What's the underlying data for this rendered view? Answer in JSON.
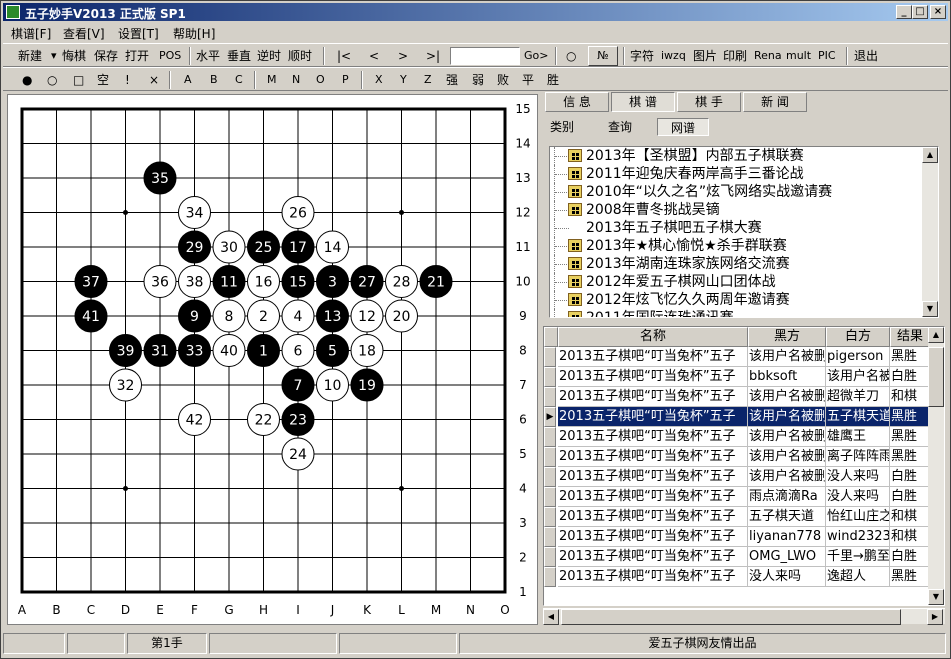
{
  "window": {
    "title": "五子妙手V2013 正式版 SP1",
    "controls": [
      "_",
      "□",
      "×"
    ]
  },
  "menu": [
    "棋谱[F]",
    "查看[V]",
    "设置[T]",
    "帮助[H]"
  ],
  "toolbar1": {
    "file": [
      "新建",
      "悔棋",
      "保存",
      "打开",
      "POS"
    ],
    "view": [
      "水平",
      "垂直",
      "逆时",
      "顺时"
    ],
    "nav": [
      "|<",
      "<",
      ">",
      ">|"
    ],
    "move_input": "",
    "go": "Go>",
    "extra": [
      "○",
      "№"
    ],
    "tools": [
      "字符",
      "iwzq",
      "图片",
      "印刷",
      "Rena",
      "mult",
      "PIC"
    ],
    "exit": "退出"
  },
  "toolbar2": {
    "marks": [
      "●",
      "○",
      "□",
      "空",
      "!",
      "×"
    ],
    "letters": [
      "A",
      "B",
      "C",
      "M",
      "N",
      "O",
      "P",
      "X",
      "Y",
      "Z",
      "强",
      "弱",
      "败",
      "平",
      "胜"
    ]
  },
  "board": {
    "cols": [
      "A",
      "B",
      "C",
      "D",
      "E",
      "F",
      "G",
      "H",
      "I",
      "J",
      "K",
      "L",
      "M",
      "N",
      "O"
    ],
    "rows": [
      "15",
      "14",
      "13",
      "12",
      "11",
      "10",
      "9",
      "8",
      "7",
      "6",
      "5",
      "4",
      "3",
      "2",
      "1"
    ],
    "stars": [
      [
        3,
        3
      ],
      [
        11,
        3
      ],
      [
        7,
        7
      ],
      [
        3,
        11
      ],
      [
        11,
        11
      ]
    ],
    "stones": [
      {
        "n": "1",
        "c": "b",
        "col": "H",
        "row": "8"
      },
      {
        "n": "2",
        "c": "w",
        "col": "H",
        "row": "9"
      },
      {
        "n": "3",
        "c": "b",
        "col": "J",
        "row": "10"
      },
      {
        "n": "4",
        "c": "w",
        "col": "I",
        "row": "9"
      },
      {
        "n": "5",
        "c": "b",
        "col": "J",
        "row": "8"
      },
      {
        "n": "6",
        "c": "w",
        "col": "I",
        "row": "8"
      },
      {
        "n": "7",
        "c": "b",
        "col": "I",
        "row": "7"
      },
      {
        "n": "8",
        "c": "w",
        "col": "G",
        "row": "9"
      },
      {
        "n": "9",
        "c": "b",
        "col": "F",
        "row": "9"
      },
      {
        "n": "10",
        "c": "w",
        "col": "J",
        "row": "7"
      },
      {
        "n": "11",
        "c": "b",
        "col": "G",
        "row": "10"
      },
      {
        "n": "12",
        "c": "w",
        "col": "K",
        "row": "9"
      },
      {
        "n": "13",
        "c": "b",
        "col": "J",
        "row": "9"
      },
      {
        "n": "14",
        "c": "w",
        "col": "J",
        "row": "11"
      },
      {
        "n": "15",
        "c": "b",
        "col": "I",
        "row": "10"
      },
      {
        "n": "16",
        "c": "w",
        "col": "H",
        "row": "10"
      },
      {
        "n": "17",
        "c": "b",
        "col": "I",
        "row": "11"
      },
      {
        "n": "18",
        "c": "w",
        "col": "K",
        "row": "8"
      },
      {
        "n": "19",
        "c": "b",
        "col": "K",
        "row": "7"
      },
      {
        "n": "20",
        "c": "w",
        "col": "L",
        "row": "9"
      },
      {
        "n": "21",
        "c": "b",
        "col": "M",
        "row": "10"
      },
      {
        "n": "22",
        "c": "w",
        "col": "H",
        "row": "6"
      },
      {
        "n": "23",
        "c": "b",
        "col": "I",
        "row": "6"
      },
      {
        "n": "24",
        "c": "w",
        "col": "I",
        "row": "5"
      },
      {
        "n": "25",
        "c": "b",
        "col": "H",
        "row": "11"
      },
      {
        "n": "26",
        "c": "w",
        "col": "I",
        "row": "12"
      },
      {
        "n": "27",
        "c": "b",
        "col": "K",
        "row": "10"
      },
      {
        "n": "28",
        "c": "w",
        "col": "L",
        "row": "10"
      },
      {
        "n": "29",
        "c": "b",
        "col": "F",
        "row": "11"
      },
      {
        "n": "30",
        "c": "w",
        "col": "G",
        "row": "11"
      },
      {
        "n": "31",
        "c": "b",
        "col": "E",
        "row": "8"
      },
      {
        "n": "32",
        "c": "w",
        "col": "D",
        "row": "7"
      },
      {
        "n": "33",
        "c": "b",
        "col": "F",
        "row": "8"
      },
      {
        "n": "34",
        "c": "w",
        "col": "F",
        "row": "12"
      },
      {
        "n": "35",
        "c": "b",
        "col": "E",
        "row": "13"
      },
      {
        "n": "36",
        "c": "w",
        "col": "E",
        "row": "10"
      },
      {
        "n": "37",
        "c": "b",
        "col": "C",
        "row": "10"
      },
      {
        "n": "38",
        "c": "w",
        "col": "F",
        "row": "10"
      },
      {
        "n": "39",
        "c": "b",
        "col": "D",
        "row": "8"
      },
      {
        "n": "40",
        "c": "w",
        "col": "G",
        "row": "8"
      },
      {
        "n": "41",
        "c": "b",
        "col": "C",
        "row": "9"
      },
      {
        "n": "42",
        "c": "w",
        "col": "F",
        "row": "6"
      }
    ]
  },
  "tabs": [
    "信 息",
    "棋 谱",
    "棋 手",
    "新 闻"
  ],
  "subtabs": [
    "类别",
    "查询",
    "网谱"
  ],
  "tree": [
    "2013年【圣棋盟】内部五子棋联赛",
    "2011年迎兔庆春两岸高手三番论战",
    "2010年“以久之名”炫飞网络实战邀请赛",
    "2008年曹冬挑战吴镝",
    "2013年五子棋吧五子棋大赛",
    "2013年★棋心愉悦★杀手群联赛",
    "2013年湖南连珠家族网络交流赛",
    "2012年爱五子棋网山口团体战",
    "2012年炫飞忆久久两周年邀请赛",
    "2011年国际连珠通讯赛"
  ],
  "grid": {
    "headers": [
      "名称",
      "黑方",
      "白方",
      "结果"
    ],
    "rows": [
      [
        "2013五子棋吧“叮当兔杯”五子",
        "该用户名被删",
        "pigerson",
        "黑胜"
      ],
      [
        "2013五子棋吧“叮当兔杯”五子",
        "bbksoft",
        "该用户名被删",
        "白胜"
      ],
      [
        "2013五子棋吧“叮当兔杯”五子",
        "该用户名被删",
        "超微羊刀",
        "和棋"
      ],
      [
        "2013五子棋吧“叮当兔杯”五子",
        "该用户名被删",
        "五子棋天道",
        "黑胜"
      ],
      [
        "2013五子棋吧“叮当兔杯”五子",
        "该用户名被删",
        "雄鹰王",
        "黑胜"
      ],
      [
        "2013五子棋吧“叮当兔杯”五子",
        "该用户名被删",
        "离子阵阵雨",
        "黑胜"
      ],
      [
        "2013五子棋吧“叮当兔杯”五子",
        "该用户名被删",
        "没人来吗",
        "白胜"
      ],
      [
        "2013五子棋吧“叮当兔杯”五子",
        "雨点滴滴Ra",
        "没人来吗",
        "白胜"
      ],
      [
        "2013五子棋吧“叮当兔杯”五子",
        "五子棋天道",
        "怡红山庄之",
        "和棋"
      ],
      [
        "2013五子棋吧“叮当兔杯”五子",
        "liyanan778",
        "wind2323",
        "和棋"
      ],
      [
        "2013五子棋吧“叮当兔杯”五子",
        "OMG_LWO",
        "千里→鹏至",
        "白胜"
      ],
      [
        "2013五子棋吧“叮当兔杯”五子",
        "没人来吗",
        "逸超人",
        "黑胜"
      ]
    ],
    "selected": 3
  },
  "status": {
    "move": "第1手",
    "credit": "爱五子棋网友情出品"
  }
}
